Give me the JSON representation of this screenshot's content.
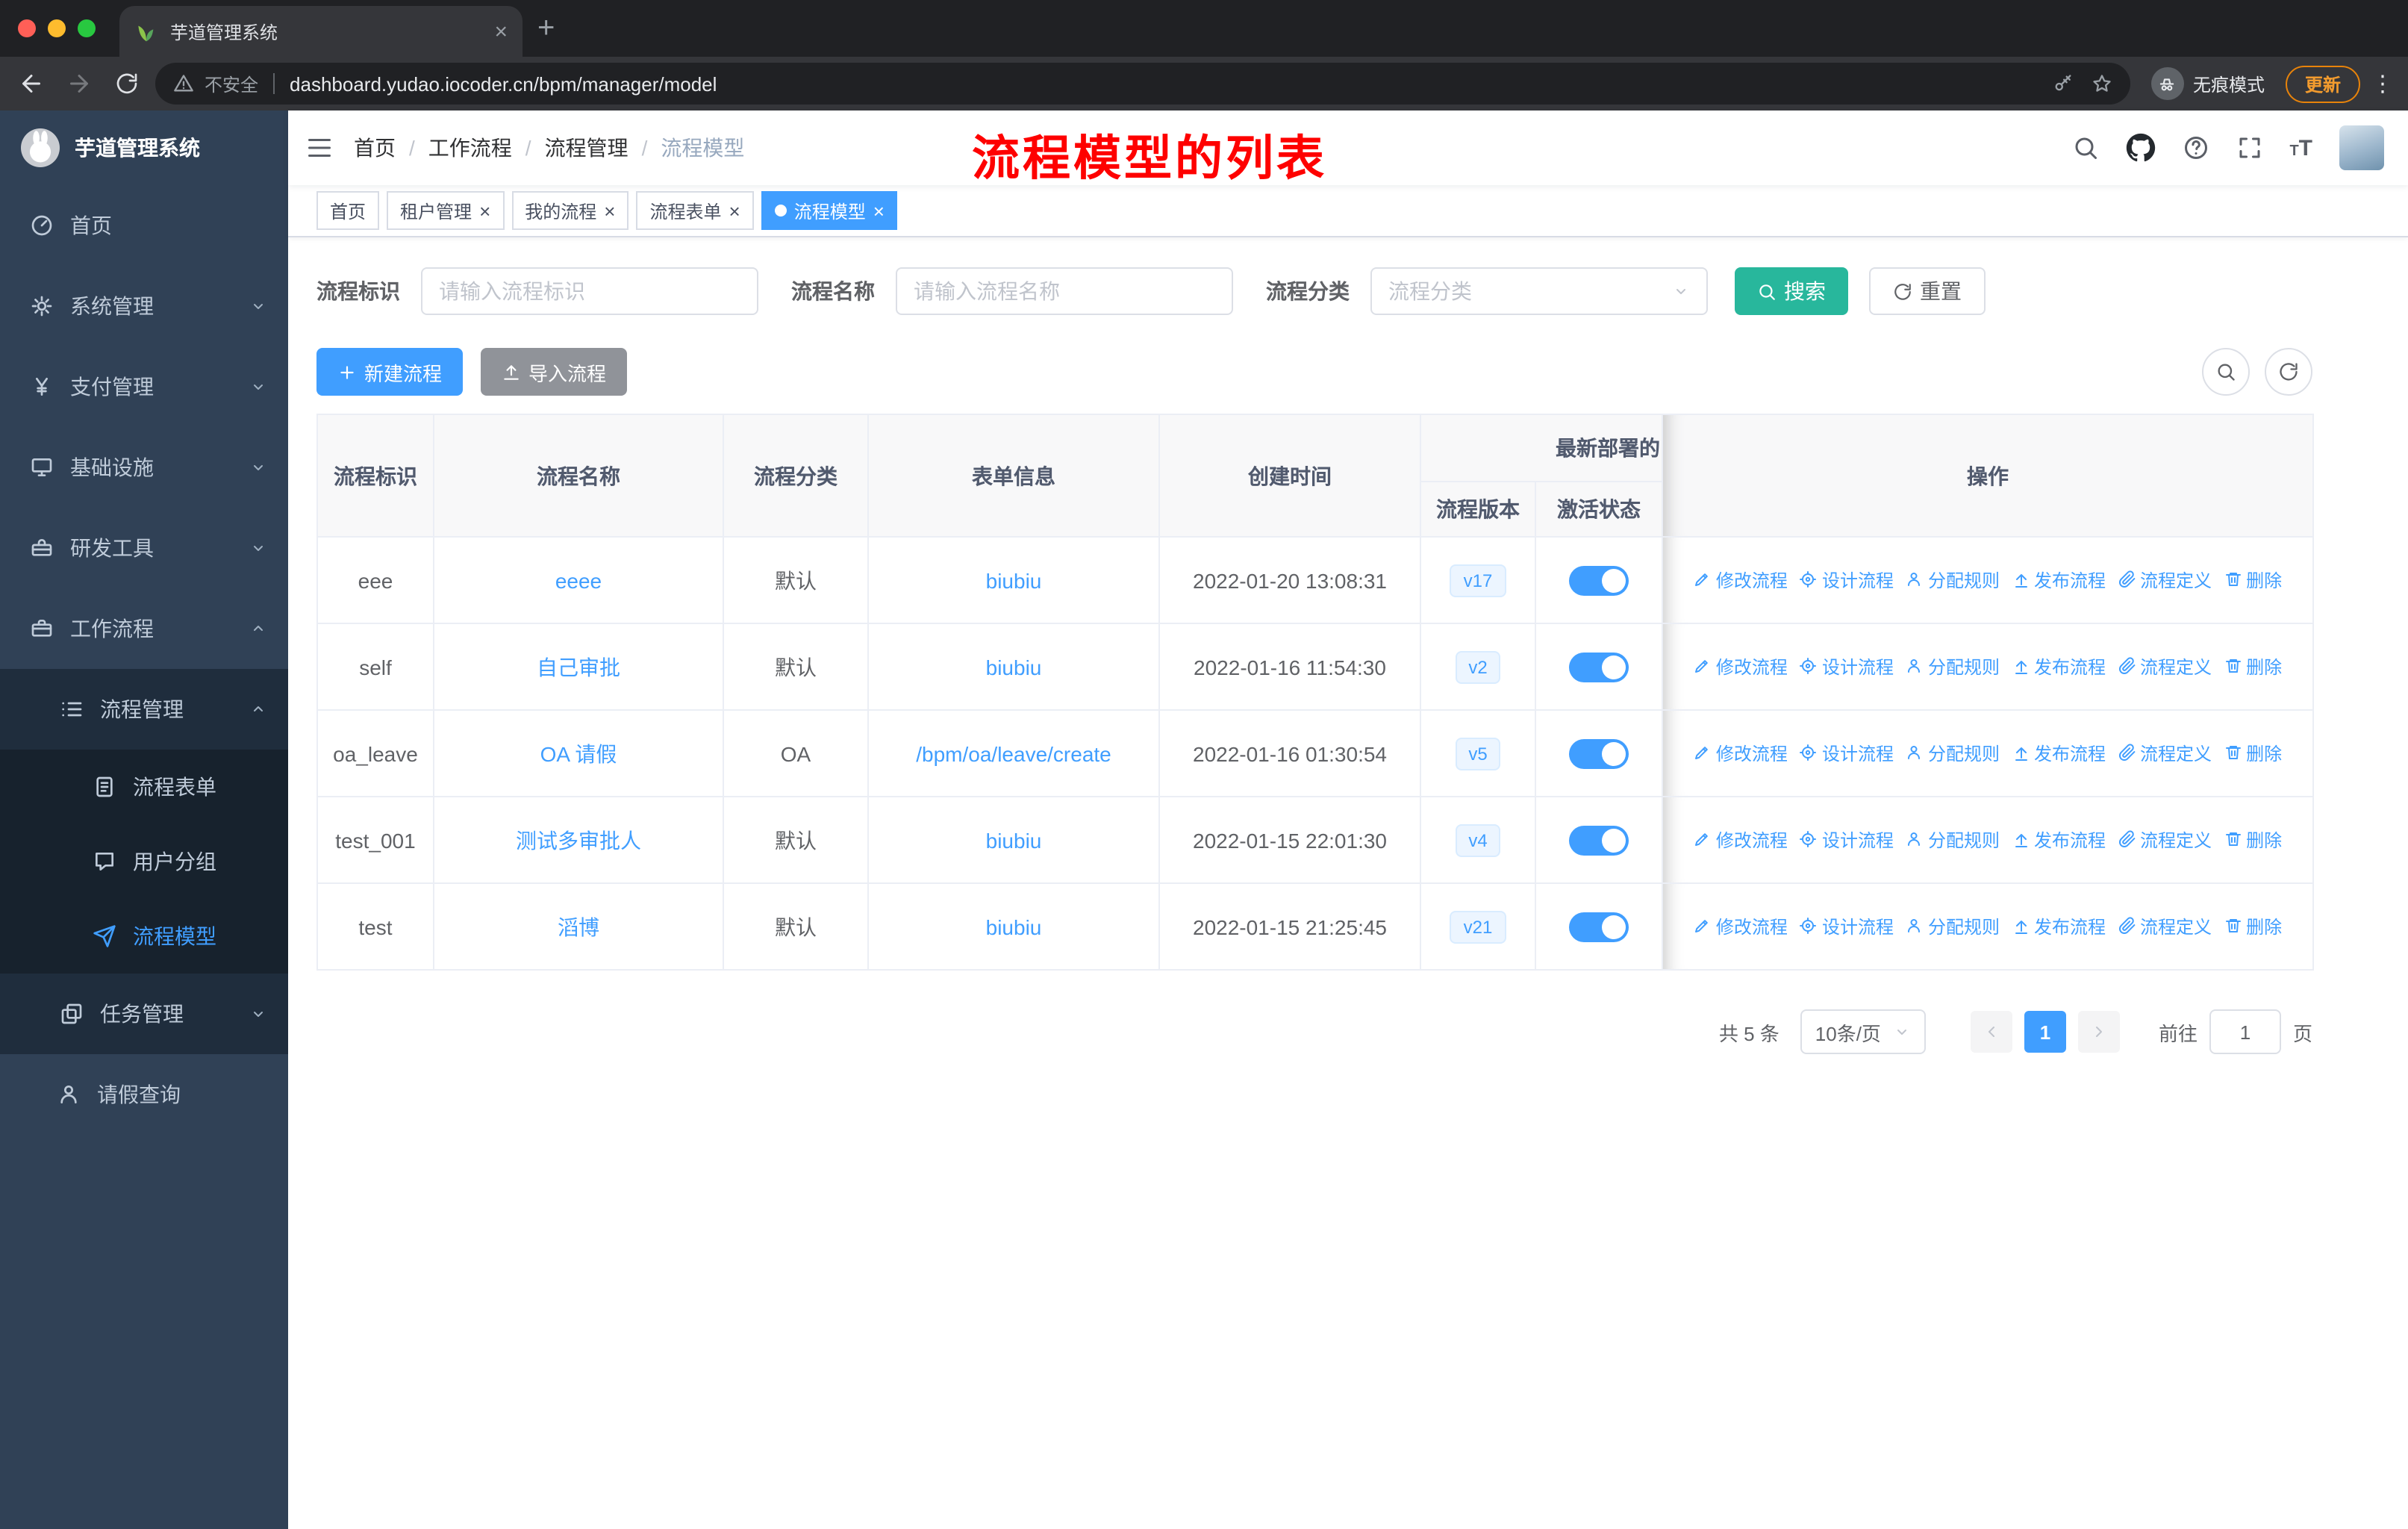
{
  "browser": {
    "tab_title": "芋道管理系统",
    "security_label": "不安全",
    "url": "dashboard.yudao.iocoder.cn/bpm/manager/model",
    "incognito_label": "无痕模式",
    "update_label": "更新"
  },
  "icons": {
    "close": "×",
    "new_tab": "+",
    "more": "⋮",
    "font_size": "T"
  },
  "sidebar": {
    "title": "芋道管理系统",
    "menu": [
      {
        "label": "首页"
      },
      {
        "label": "系统管理"
      },
      {
        "label": "支付管理"
      },
      {
        "label": "基础设施"
      },
      {
        "label": "研发工具"
      },
      {
        "label": "工作流程"
      }
    ],
    "submenu": {
      "process": {
        "label": "流程管理"
      },
      "children": [
        {
          "label": "流程表单"
        },
        {
          "label": "用户分组"
        },
        {
          "label": "流程模型"
        }
      ],
      "task": {
        "label": "任务管理"
      }
    },
    "leave": {
      "label": "请假查询"
    }
  },
  "header": {
    "breadcrumb": [
      {
        "label": "首页"
      },
      {
        "label": "工作流程"
      },
      {
        "label": "流程管理"
      },
      {
        "label": "流程模型"
      }
    ],
    "annotation": "流程模型的列表"
  },
  "tags": [
    {
      "label": "首页"
    },
    {
      "label": "租户管理"
    },
    {
      "label": "我的流程"
    },
    {
      "label": "流程表单"
    },
    {
      "label": "流程模型"
    }
  ],
  "filters": {
    "key_label": "流程标识",
    "key_placeholder": "请输入流程标识",
    "name_label": "流程名称",
    "name_placeholder": "请输入流程名称",
    "category_label": "流程分类",
    "category_placeholder": "流程分类",
    "search_label": "搜索",
    "reset_label": "重置"
  },
  "toolbar": {
    "create_label": "新建流程",
    "import_label": "导入流程"
  },
  "table": {
    "headers": {
      "key": "流程标识",
      "name": "流程名称",
      "category": "流程分类",
      "form": "表单信息",
      "created": "创建时间",
      "deploy_group": "最新部署的",
      "version": "流程版本",
      "active": "激活状态",
      "actions": "操作"
    },
    "action_labels": [
      "修改流程",
      "设计流程",
      "分配规则",
      "发布流程",
      "流程定义",
      "删除"
    ],
    "rows": [
      {
        "key": "eee",
        "name": "eeee",
        "category": "默认",
        "form": "biubiu",
        "created": "2022-01-20 13:08:31",
        "version": "v17",
        "active": true
      },
      {
        "key": "self",
        "name": "自己审批",
        "category": "默认",
        "form": "biubiu",
        "created": "2022-01-16 11:54:30",
        "version": "v2",
        "active": true
      },
      {
        "key": "oa_leave",
        "name": "OA 请假",
        "category": "OA",
        "form": "/bpm/oa/leave/create",
        "created": "2022-01-16 01:30:54",
        "version": "v5",
        "active": true
      },
      {
        "key": "test_001",
        "name": "测试多审批人",
        "category": "默认",
        "form": "biubiu",
        "created": "2022-01-15 22:01:30",
        "version": "v4",
        "active": true
      },
      {
        "key": "test",
        "name": "滔博",
        "category": "默认",
        "form": "biubiu",
        "created": "2022-01-15 21:25:45",
        "version": "v21",
        "active": true
      }
    ]
  },
  "pagination": {
    "total": "共 5 条",
    "page_size": "10条/页",
    "current_page": "1",
    "goto_label": "前往",
    "goto_value": "1",
    "page_unit": "页"
  },
  "colors": {
    "primary": "#409eff",
    "search_button": "#28b79c",
    "sidebar_bg": "#304156",
    "submenu_bg": "#1f2d3d",
    "annotation": "#fe0100",
    "badge_bg": "#ecf5ff"
  }
}
